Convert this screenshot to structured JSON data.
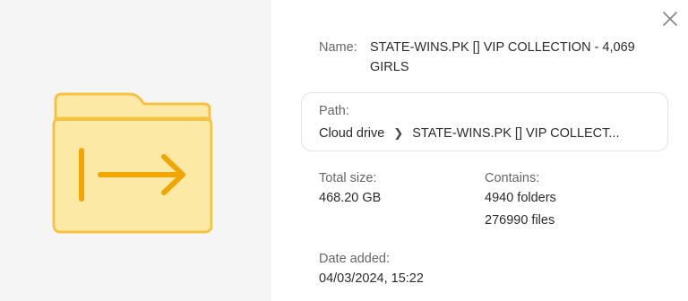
{
  "dialog": {
    "name_label": "Name:",
    "name_value": "STATE-WINS.PK [] VIP COLLECTION - 4,069 GIRLS",
    "path_label": "Path:",
    "path_crumbs": [
      "Cloud drive",
      "STATE-WINS.PK [] VIP COLLECT..."
    ],
    "total_size_label": "Total size:",
    "total_size_value": "468.20 GB",
    "contains_label": "Contains:",
    "contains_folders": "4940 folders",
    "contains_files": "276990 files",
    "date_added_label": "Date added:",
    "date_added_value": "04/03/2024, 15:22"
  },
  "icons": {
    "close": "close-icon",
    "folder": "folder-shared-out-icon",
    "breadcrumb_separator": "chevron-right-icon"
  },
  "colors": {
    "folder_fill": "#fde9a6",
    "folder_stroke": "#f5c242",
    "arrow": "#f0a500",
    "left_pane_bg": "#f5f5f5"
  }
}
